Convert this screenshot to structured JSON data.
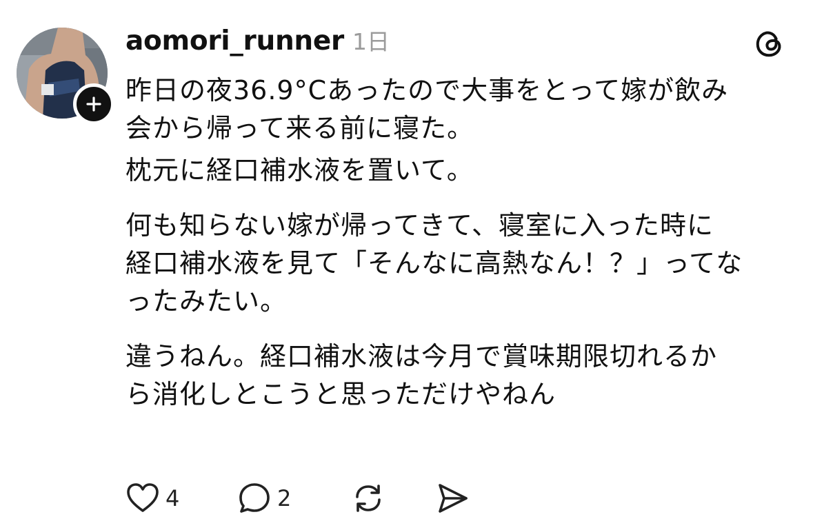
{
  "post": {
    "username": "aomori_runner",
    "timestamp": "1日",
    "paragraphs": [
      "昨日の夜36.9°Cあったので大事をとって嫁が飲み\n会から帰って来る前に寝た。",
      "枕元に経口補水液を置いて。",
      "何も知らない嫁が帰ってきて、寝室に入った時に\n経口補水液を見て「そんなに高熱なん！？」ってな\nったみたい。",
      "違うねん。経口補水液は今月で賞味期限切れるか\nら消化しとこうと思っただけやねん"
    ]
  },
  "actions": {
    "like_count": "4",
    "reply_count": "2"
  },
  "icons": {
    "avatar": "avatar-photo-runner",
    "follow": "plus-icon",
    "brand": "threads-logo-icon",
    "like": "heart-icon",
    "reply": "comment-bubble-icon",
    "repost": "repost-icon",
    "share": "send-icon"
  },
  "colors": {
    "text": "#111111",
    "muted": "#9b9b9b",
    "background": "#ffffff"
  }
}
